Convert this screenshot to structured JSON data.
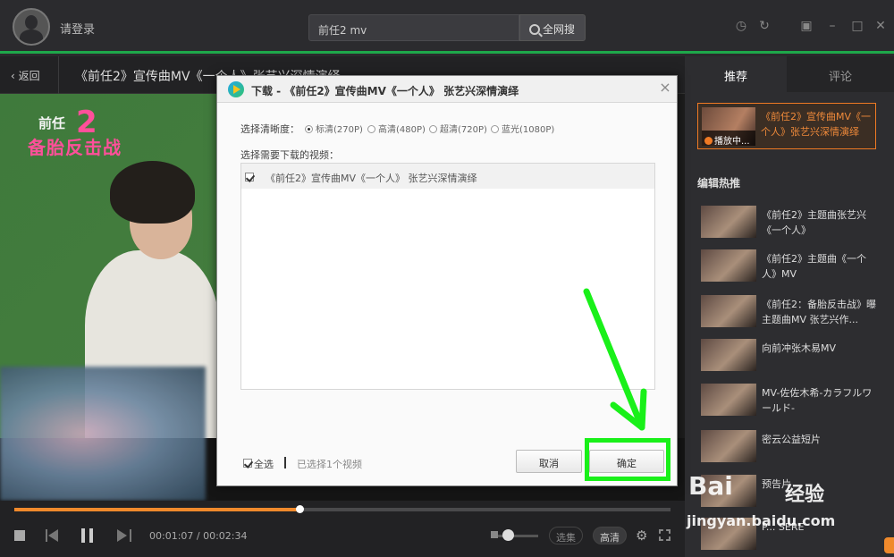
{
  "top": {
    "login": "请登录",
    "search_value": "前任2 mv",
    "search_button": "全网搜"
  },
  "titlebar": {
    "back": "返回",
    "video_title": "《前任2》宣传曲MV《一个人》张艺兴深情演绎"
  },
  "video_overlay": {
    "logo_line1": "前任",
    "logo_line2": "备胎反击战",
    "logo_num": "2"
  },
  "player": {
    "time": "00:01:07 / 00:02:34",
    "progress": 0.435,
    "volume": 0.35,
    "episodes": "选集",
    "quality": "高清"
  },
  "sidebar": {
    "tab_recommend": "推荐",
    "tab_comment": "评论",
    "now_playing": {
      "title": "《前任2》宣传曲MV《一个人》张艺兴深情演绎",
      "badge": "播放中..."
    },
    "hot_header": "编辑热推",
    "hot_items": [
      {
        "title": "《前任2》主题曲张艺兴《一个人》"
      },
      {
        "title": "《前任2》主题曲《一个人》MV"
      },
      {
        "title": "《前任2：备胎反击战》曝主题曲MV 张艺兴作..."
      },
      {
        "title": "向前冲张木易MV"
      },
      {
        "title": "MV-佐佐木希-カラフルワールド-"
      },
      {
        "title": "密云公益短片"
      },
      {
        "title": "预告片"
      },
      {
        "title": "P... SERE"
      }
    ]
  },
  "dialog": {
    "title": "下载 - 《前任2》宣传曲MV《一个人》 张艺兴深情演绎",
    "quality_label": "选择清晰度：",
    "quality_options": [
      {
        "label": "标清(270P)",
        "selected": true
      },
      {
        "label": "高清(480P)",
        "selected": false
      },
      {
        "label": "超清(720P)",
        "selected": false
      },
      {
        "label": "蓝光(1080P)",
        "selected": false
      }
    ],
    "video_label": "选择需要下载的视频：",
    "videos": [
      {
        "title": "《前任2》宣传曲MV《一个人》 张艺兴深情演绎",
        "checked": true
      }
    ],
    "select_all": "全选",
    "selected_count": "已选择1个视频",
    "cancel": "取消",
    "confirm": "确定"
  },
  "annotation": {
    "color": "#19f019"
  },
  "watermark": {
    "brand": "Bai",
    "product": "经验",
    "url": "jingyan.baidu.com"
  },
  "colors": {
    "accent_green": "#1ea84a",
    "progress_orange": "#f08a2c"
  }
}
